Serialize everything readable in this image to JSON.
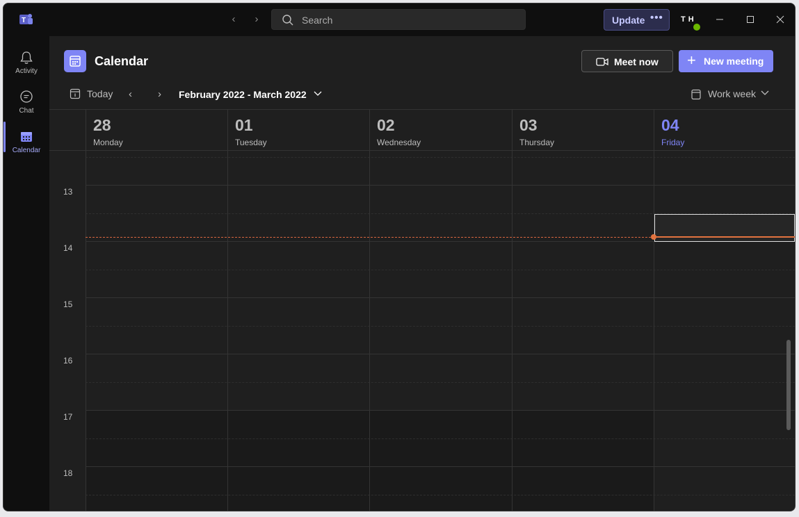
{
  "titlebar": {
    "search_placeholder": "Search",
    "update_label": "Update",
    "update_more": "•••",
    "avatar_initials": "TH"
  },
  "rail": {
    "items": [
      {
        "label": "Activity",
        "icon": "bell-icon"
      },
      {
        "label": "Chat",
        "icon": "chat-icon"
      },
      {
        "label": "Calendar",
        "icon": "calendar-icon",
        "active": true
      }
    ]
  },
  "header": {
    "title": "Calendar",
    "meet_now_label": "Meet now",
    "new_meeting_label": "New meeting"
  },
  "toolbar": {
    "today_label": "Today",
    "range_label": "February 2022 - March 2022",
    "view_label": "Work week"
  },
  "days": [
    {
      "num": "28",
      "name": "Monday"
    },
    {
      "num": "01",
      "name": "Tuesday"
    },
    {
      "num": "02",
      "name": "Wednesday"
    },
    {
      "num": "03",
      "name": "Thursday"
    },
    {
      "num": "04",
      "name": "Friday",
      "today": true
    }
  ],
  "hours": [
    "13",
    "14",
    "15",
    "16",
    "17",
    "18"
  ],
  "colors": {
    "accent": "#7f85f5",
    "now_line": "#e2733f",
    "background": "#1f1f1f"
  }
}
